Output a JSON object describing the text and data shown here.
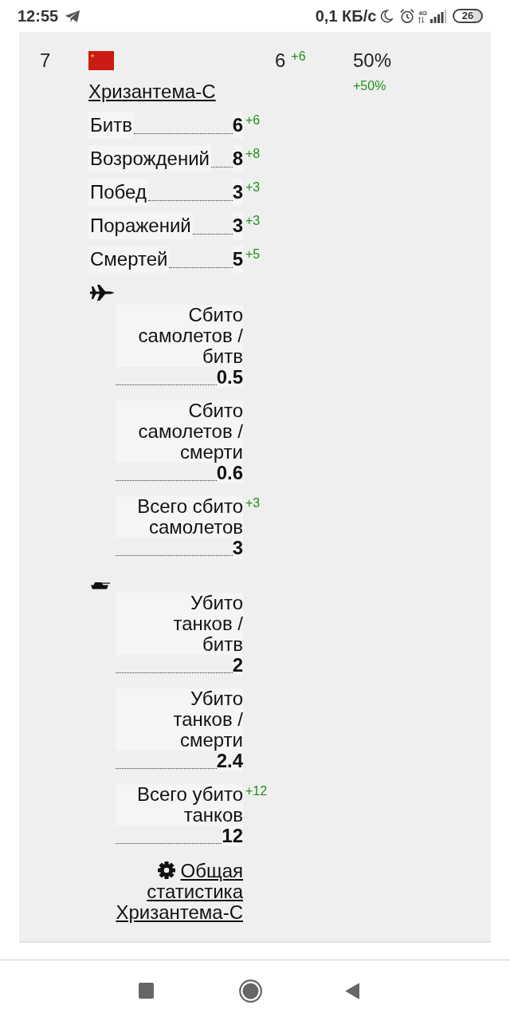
{
  "status_bar": {
    "time": "12:55",
    "network_speed": "0,1 КБ/с",
    "network_type": "4G",
    "battery": "26"
  },
  "entry": {
    "rank": "7",
    "name": "Хризантема-С",
    "battles": {
      "value": "6",
      "delta": "+6"
    },
    "win_rate": {
      "value": "50%",
      "delta": "+50%"
    },
    "stats": [
      {
        "label": "Битв",
        "value": "6",
        "delta": "+6"
      },
      {
        "label": "Возрождений",
        "value": "8",
        "delta": "+8"
      },
      {
        "label": "Побед",
        "value": "3",
        "delta": "+3"
      },
      {
        "label": "Поражений",
        "value": "3",
        "delta": "+3"
      },
      {
        "label": "Смертей",
        "value": "5",
        "delta": "+5"
      }
    ],
    "groups": [
      {
        "kind": "aircraft",
        "stats": [
          {
            "label": "Сбито самолетов / битв",
            "value": "0.5"
          },
          {
            "label": "Сбито самолетов / смерти",
            "value": "0.6"
          },
          {
            "label": "Всего сбито самолетов",
            "value": "3",
            "delta": "+3"
          }
        ]
      },
      {
        "kind": "tank",
        "stats": [
          {
            "label": "Убито танков / битв",
            "value": "2"
          },
          {
            "label": "Убито танков / смерти",
            "value": "2.4"
          },
          {
            "label": "Всего убито танков",
            "value": "12",
            "delta": "+12"
          }
        ]
      }
    ],
    "link": "Общая статистика Хризантема-С"
  }
}
